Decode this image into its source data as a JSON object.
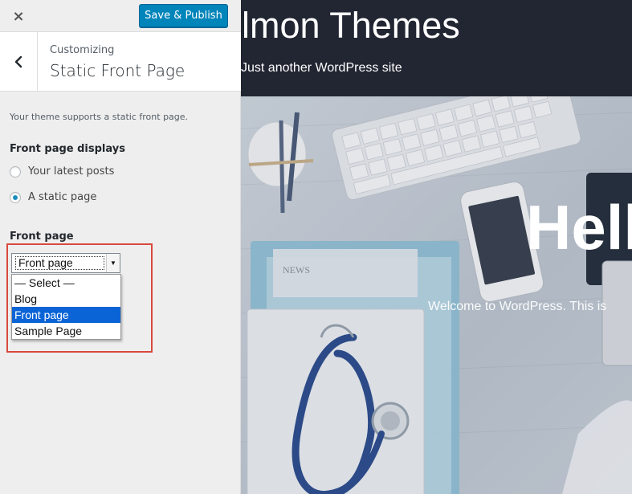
{
  "toolbar": {
    "close_icon": "×",
    "publish_label": "Save & Publish"
  },
  "section": {
    "back_icon": "‹",
    "subtitle": "Customizing",
    "title": "Static Front Page"
  },
  "description": "Your theme supports a static front page.",
  "front_page_displays": {
    "label": "Front page displays",
    "options": [
      {
        "label": "Your latest posts",
        "checked": false
      },
      {
        "label": "A static page",
        "checked": true
      }
    ]
  },
  "front_page": {
    "label": "Front page",
    "selected": "Front page",
    "options": [
      "— Select —",
      "Blog",
      "Front page",
      "Sample Page"
    ]
  },
  "preview": {
    "site_title": "lmon Themes",
    "site_tagline": "Just another WordPress site",
    "hero_title": "Hell",
    "hero_text": "Welcome to WordPress. This is"
  },
  "colors": {
    "accent": "#0085ba",
    "highlight_border": "#d9493e",
    "header_bg": "#222632",
    "dropdown_selected": "#0b64d6"
  }
}
